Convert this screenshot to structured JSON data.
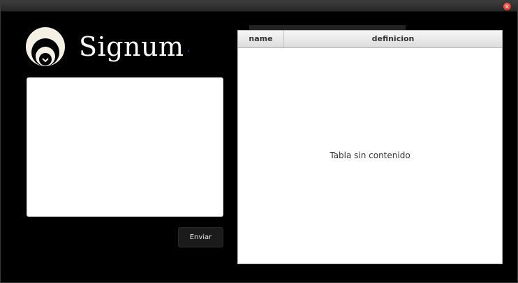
{
  "window": {
    "close_glyph": "×"
  },
  "header": {
    "app_title": "Signum",
    "logo_icon": "signum-logo-icon"
  },
  "input": {
    "value": "",
    "placeholder": ""
  },
  "actions": {
    "send_label": "Enviar"
  },
  "table": {
    "columns": [
      "name",
      "definicion"
    ],
    "rows": [],
    "empty_message": "Tabla sin contenido"
  },
  "colors": {
    "background": "#000000",
    "close_button": "#d8302a",
    "table_header": "#e6e6e6"
  }
}
